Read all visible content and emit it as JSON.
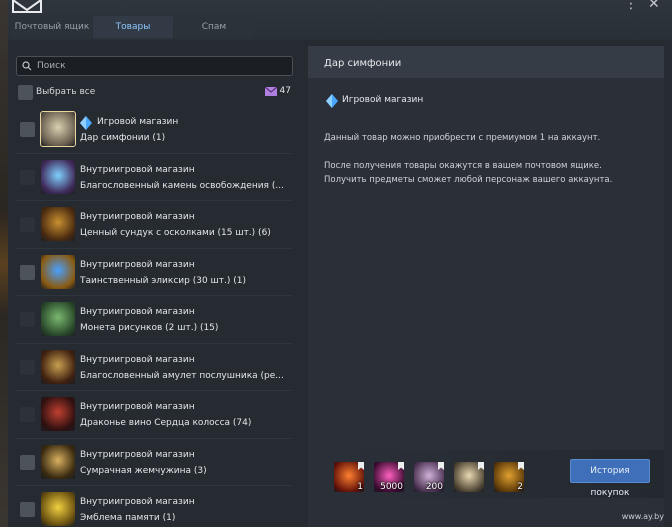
{
  "tabs": [
    {
      "label": "Почтовый ящик",
      "active": false
    },
    {
      "label": "Товары",
      "active": true
    },
    {
      "label": "Спам",
      "active": false
    }
  ],
  "window_controls": {
    "menu": "⋮",
    "close": "✕"
  },
  "search": {
    "placeholder": "Поиск",
    "value": ""
  },
  "select_all": {
    "label": "Выбрать все",
    "count": "47"
  },
  "items": [
    {
      "source": "Игровой магазин",
      "name": "Дар симфонии (1)",
      "selected": true,
      "crystal": true,
      "thumb": "gift-box-icon",
      "colors": [
        "#d8d0b0",
        "#6b6050"
      ]
    },
    {
      "source": "Внутриигровой магазин",
      "name": "Благословенный камень освобождения (...",
      "thumb": "crystal-stone-icon",
      "colors": [
        "#7fd0ff",
        "#402a5a"
      ]
    },
    {
      "source": "Внутриигровой магазин",
      "name": "Ценный сундук с осколками (15 шт.) (6)",
      "thumb": "treasure-chest-icon",
      "colors": [
        "#c89030",
        "#4a2a10"
      ]
    },
    {
      "source": "Внутриигровой магазин",
      "name": "Таинственный эликсир (30 шт.) (1)",
      "thumb": "elixir-icon",
      "colors": [
        "#4aa0ff",
        "#8a5a10"
      ]
    },
    {
      "source": "Внутриигровой магазин",
      "name": "Монета рисунков (2 шт.) (15)",
      "thumb": "green-book-icon",
      "colors": [
        "#7ab870",
        "#2a4a2a"
      ]
    },
    {
      "source": "Внутриигровой магазин",
      "name": "Благословенный амулет послушника (ре...",
      "thumb": "amulet-icon",
      "colors": [
        "#c8a050",
        "#402010"
      ]
    },
    {
      "source": "Внутриигровой магазин",
      "name": "Драконье вино Сердца колосса (74)",
      "thumb": "wine-bottle-icon",
      "colors": [
        "#c04030",
        "#301010"
      ]
    },
    {
      "source": "Внутриигровой магазин",
      "name": "Сумрачная жемчужина (3)",
      "thumb": "pearl-icon",
      "colors": [
        "#d8b060",
        "#3a2a10"
      ]
    },
    {
      "source": "Внутриигровой магазин",
      "name": "Эмблема памяти (1)",
      "thumb": "emblem-icon",
      "colors": [
        "#f0d040",
        "#6a5010"
      ]
    }
  ],
  "detail": {
    "title": "Дар симфонии",
    "shop_label": "Игровой магазин",
    "line1": "Данный товар можно приобрести с премиумом 1 на аккаунт.",
    "line2": "После получения товары окажутся в вашем почтовом ящике.",
    "line3": "Получить предметы сможет любой персонаж вашего аккаунта.",
    "rewards": [
      {
        "qty": "1",
        "icon": "fire-orb-icon",
        "colors": [
          "#ff8030",
          "#601008"
        ]
      },
      {
        "qty": "5000",
        "icon": "pink-gem-icon",
        "colors": [
          "#ff60c0",
          "#3a0a30"
        ]
      },
      {
        "qty": "200",
        "icon": "feather-scroll-icon",
        "colors": [
          "#d0b0d8",
          "#4a3050"
        ]
      },
      {
        "qty": "",
        "icon": "angel-figure-icon",
        "colors": [
          "#e8d8b0",
          "#4a4030"
        ]
      },
      {
        "qty": "2",
        "icon": "gold-pile-icon",
        "colors": [
          "#e0a030",
          "#5a3808"
        ]
      }
    ],
    "history_button": "История покупок"
  },
  "watermark": "www.ay.by",
  "colors": {
    "accent_tab": "#8ec8ff",
    "button": "#3f6fb8"
  }
}
